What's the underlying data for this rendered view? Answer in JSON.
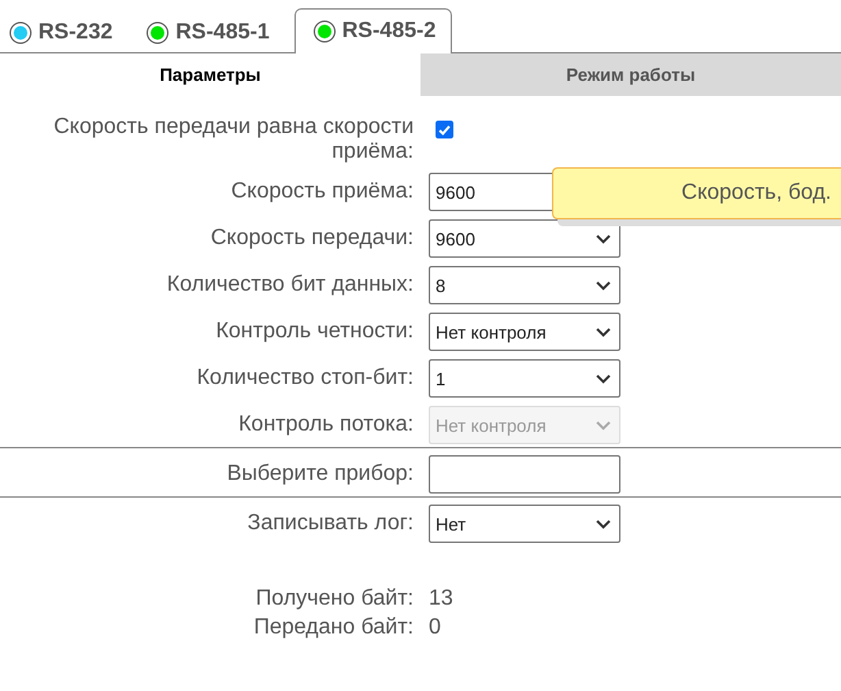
{
  "tabs": [
    {
      "label": "RS-232",
      "selected": false,
      "color": "#22ccf2"
    },
    {
      "label": "RS-485-1",
      "selected": false,
      "color": "#00e600"
    },
    {
      "label": "RS-485-2",
      "selected": true,
      "color": "#00e600"
    }
  ],
  "subtabs": [
    {
      "label": "Параметры",
      "selected": true
    },
    {
      "label": "Режим работы",
      "selected": false
    }
  ],
  "settings": [
    {
      "kind": "checkbox",
      "label": "Скорость передачи равна скорости приёма:",
      "checked": true
    },
    {
      "kind": "input",
      "label": "Скорость приёма:",
      "value": "9600"
    },
    {
      "kind": "select",
      "label": "Скорость передачи:",
      "value": "9600",
      "disabled": false
    },
    {
      "kind": "select",
      "label": "Количество бит данных:",
      "value": "8",
      "disabled": false
    },
    {
      "kind": "select",
      "label": "Контроль четности:",
      "value": "Нет контроля",
      "disabled": false
    },
    {
      "kind": "select",
      "label": "Количество стоп-бит:",
      "value": "1",
      "disabled": false
    },
    {
      "kind": "select",
      "label": "Контроль потока:",
      "value": "Нет контроля",
      "disabled": true
    },
    {
      "kind": "divider"
    },
    {
      "kind": "input",
      "label": "Выберите прибор:"
    },
    {
      "kind": "divider"
    },
    {
      "kind": "select",
      "label": "Записывать лог:",
      "value": "Нет",
      "disabled": false
    }
  ],
  "tooltip": {
    "text": "Скорость, бод."
  },
  "counters": [
    {
      "label": "Получено байт:",
      "value": "13"
    },
    {
      "label": "Передано байт:",
      "value": "0"
    }
  ]
}
